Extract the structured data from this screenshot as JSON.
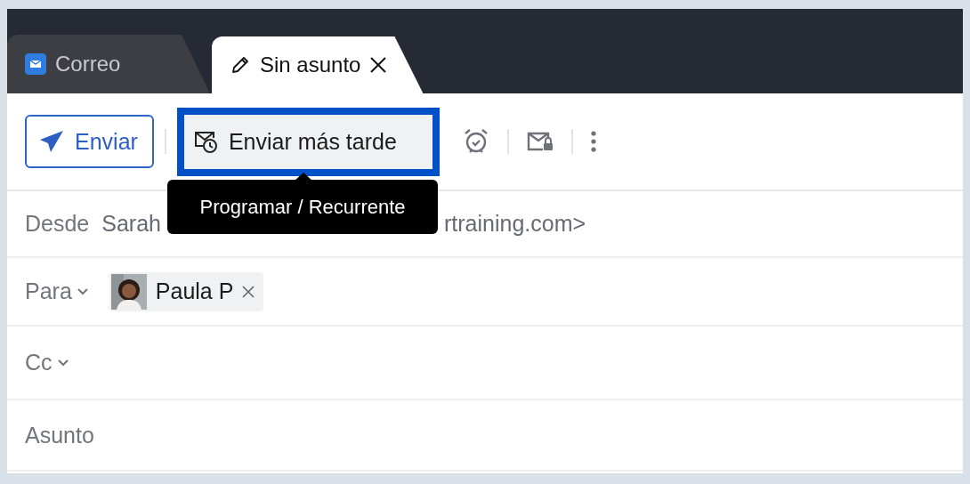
{
  "tabs": [
    {
      "label": "Correo",
      "selected": false,
      "kind": "app"
    },
    {
      "label": "Sin asunto",
      "selected": true,
      "kind": "draft"
    }
  ],
  "toolbar": {
    "send_button": "Enviar",
    "later_button": {
      "label": "Enviar más tarde",
      "highlighted": true
    },
    "tooltip": "Programar / Recurrente"
  },
  "from": {
    "label": "Desde",
    "value_parts": [
      "Sarah",
      "rtraining.com>"
    ]
  },
  "to": {
    "label": "Para",
    "recipients": [
      {
        "name": "Paula P"
      }
    ]
  },
  "cc": {
    "label": "Cc"
  },
  "subject": {
    "label": "Asunto"
  }
}
